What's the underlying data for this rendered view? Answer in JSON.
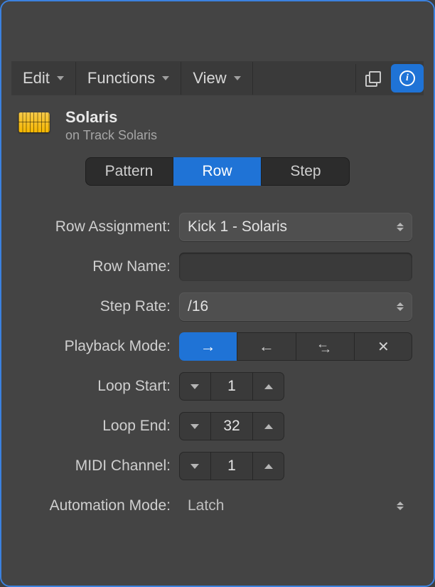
{
  "toolbar": {
    "edit": "Edit",
    "functions": "Functions",
    "view": "View"
  },
  "region": {
    "name": "Solaris",
    "subtitle": "on Track Solaris"
  },
  "tabs": {
    "pattern": "Pattern",
    "row": "Row",
    "step": "Step",
    "active": "row"
  },
  "form": {
    "rowAssignment": {
      "label": "Row Assignment:",
      "value": "Kick 1 - Solaris"
    },
    "rowName": {
      "label": "Row Name:",
      "value": ""
    },
    "stepRate": {
      "label": "Step Rate:",
      "value": "/16"
    },
    "playbackMode": {
      "label": "Playback Mode:",
      "active": 0
    },
    "loopStart": {
      "label": "Loop Start:",
      "value": "1"
    },
    "loopEnd": {
      "label": "Loop End:",
      "value": "32"
    },
    "midiChannel": {
      "label": "MIDI Channel:",
      "value": "1"
    },
    "automationMode": {
      "label": "Automation Mode:",
      "value": "Latch"
    }
  }
}
